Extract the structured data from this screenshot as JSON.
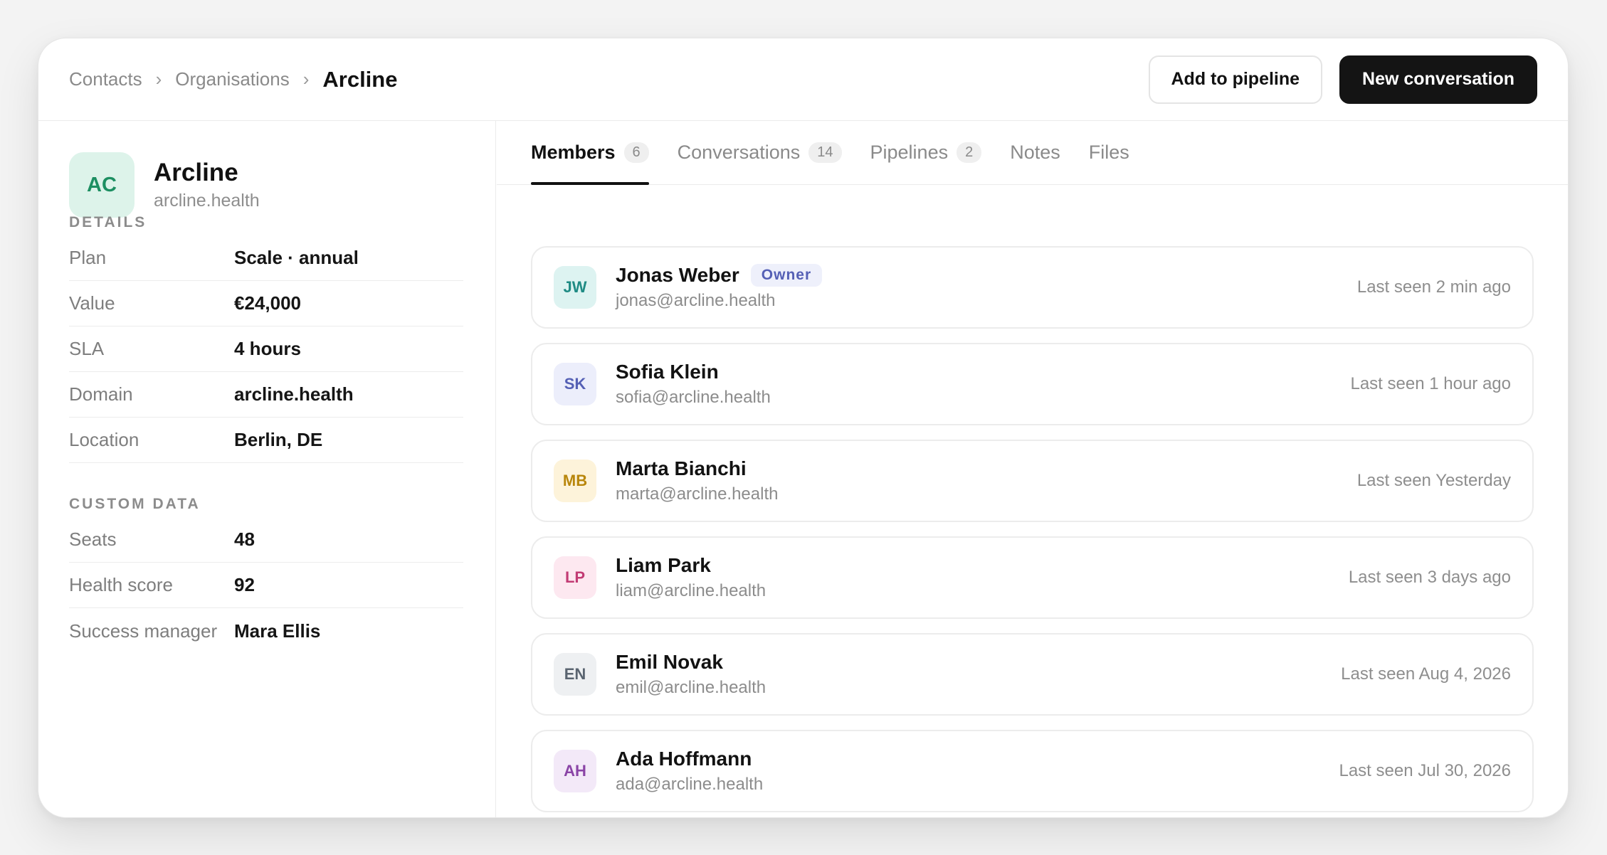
{
  "breadcrumb": {
    "items": [
      "Contacts",
      "Organisations"
    ],
    "separator": "›",
    "current": "Arcline"
  },
  "header": {
    "add_pipeline_label": "Add to pipeline",
    "new_conversation_label": "New conversation"
  },
  "organisation": {
    "initials": "AC",
    "name": "Arcline",
    "domain": "arcline.health"
  },
  "details": {
    "title": "DETAILS",
    "rows": [
      {
        "key": "Plan",
        "value": "Scale · annual"
      },
      {
        "key": "Value",
        "value": "€24,000"
      },
      {
        "key": "SLA",
        "value": "4 hours"
      },
      {
        "key": "Domain",
        "value": "arcline.health"
      },
      {
        "key": "Location",
        "value": "Berlin, DE"
      }
    ]
  },
  "custom_data": {
    "title": "CUSTOM DATA",
    "rows": [
      {
        "key": "Seats",
        "value": "48"
      },
      {
        "key": "Health score",
        "value": "92"
      },
      {
        "key": "Success manager",
        "value": "Mara Ellis"
      }
    ]
  },
  "tabs": [
    {
      "label": "Members",
      "count": "6"
    },
    {
      "label": "Conversations",
      "count": "14"
    },
    {
      "label": "Pipelines",
      "count": "2"
    },
    {
      "label": "Notes"
    },
    {
      "label": "Files"
    }
  ],
  "members": [
    {
      "initials": "JW",
      "name": "Jonas Weber",
      "badge": "Owner",
      "email": "jonas@arcline.health",
      "seen": "Last seen 2 min ago",
      "bg": "#ddf3f1",
      "fg": "#1f8b84"
    },
    {
      "initials": "SK",
      "name": "Sofia Klein",
      "email": "sofia@arcline.health",
      "seen": "Last seen 1 hour ago",
      "bg": "#eceefb",
      "fg": "#5560b5"
    },
    {
      "initials": "MB",
      "name": "Marta Bianchi",
      "email": "marta@arcline.health",
      "seen": "Last seen Yesterday",
      "bg": "#fdf3da",
      "fg": "#b8860b"
    },
    {
      "initials": "LP",
      "name": "Liam Park",
      "email": "liam@arcline.health",
      "seen": "Last seen 3 days ago",
      "bg": "#fde8f0",
      "fg": "#c23b74"
    },
    {
      "initials": "EN",
      "name": "Emil Novak",
      "email": "emil@arcline.health",
      "seen": "Last seen Aug 4, 2026",
      "bg": "#eef0f2",
      "fg": "#5a6470"
    },
    {
      "initials": "AH",
      "name": "Ada Hoffmann",
      "email": "ada@arcline.health",
      "seen": "Last seen Jul 30, 2026",
      "bg": "#f3e9f8",
      "fg": "#8a44a6"
    }
  ]
}
